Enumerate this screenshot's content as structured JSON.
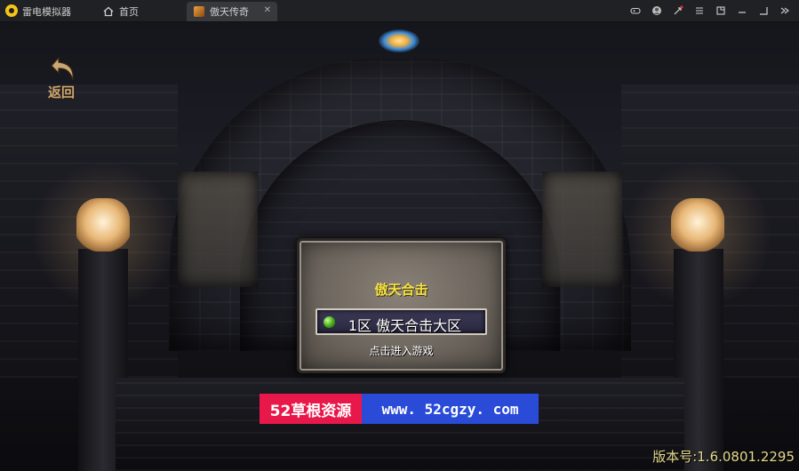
{
  "titlebar": {
    "app_name": "雷电模拟器",
    "tabs": [
      {
        "label": "首页",
        "icon": "home-icon"
      },
      {
        "label": "傲天传奇",
        "icon": "game-tab-icon"
      }
    ],
    "tab_close_symbol": "✕"
  },
  "window_controls": [
    "gamepad-icon",
    "avatar-icon",
    "mail-icon",
    "menu-icon",
    "restore-icon",
    "minimize-icon",
    "maximize-icon",
    "collapse-icon"
  ],
  "game": {
    "back_label": "返回",
    "dialog": {
      "title": "傲天合击",
      "server_name": "1区 傲天合击大区",
      "enter_hint": "点击进入游戏",
      "status_color": "#3fa814"
    },
    "watermark": {
      "left_text": "52草根资源",
      "right_text": "www. 52cgzy. com"
    },
    "version": "版本号:1.6.0801.2295"
  },
  "colors": {
    "accent_gold": "#c9a775",
    "title_yellow": "#f4e04a",
    "banner_red": "#e8194a",
    "banner_blue": "#2a4bd8"
  }
}
